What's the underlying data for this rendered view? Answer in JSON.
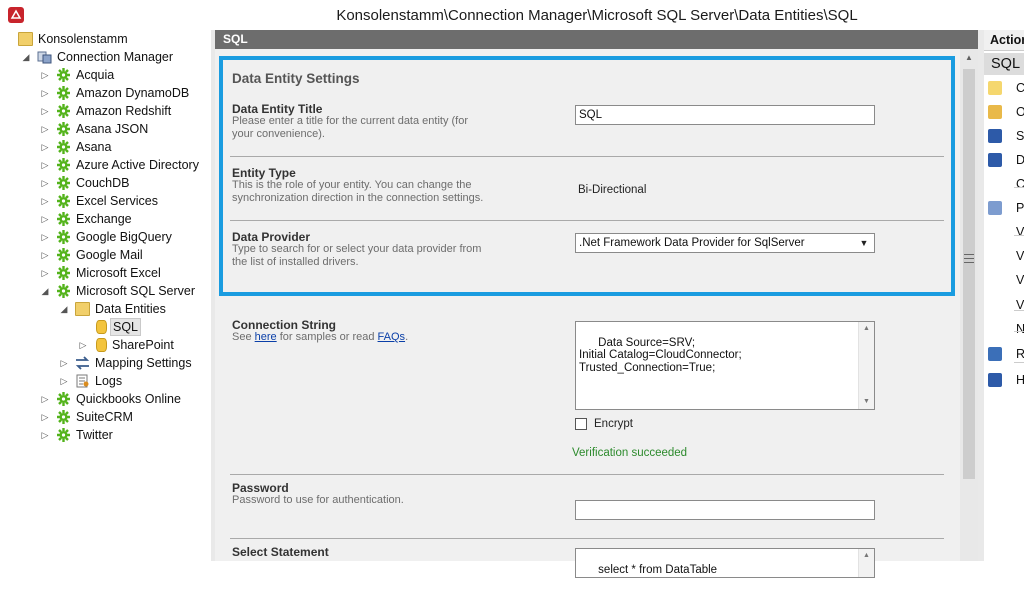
{
  "window": {
    "title": "Konsolenstamm\\Connection Manager\\Microsoft SQL Server\\Data Entities\\SQL"
  },
  "tree": {
    "root": "Konsolenstamm",
    "manager": "Connection Manager",
    "connectors": [
      "Acquia",
      "Amazon DynamoDB",
      "Amazon Redshift",
      "Asana JSON",
      "Asana",
      "Azure Active Directory",
      "CouchDB",
      "Excel Services",
      "Exchange",
      "Google BigQuery",
      "Google Mail",
      "Microsoft Excel",
      "Microsoft SQL Server"
    ],
    "sql_children": {
      "data_entities": "Data Entities",
      "sql": "SQL",
      "sharepoint": "SharePoint",
      "mapping": "Mapping Settings",
      "logs": "Logs"
    },
    "connectors_after": [
      "Quickbooks Online",
      "SuiteCRM",
      "Twitter"
    ]
  },
  "center": {
    "header": "SQL",
    "settings_heading": "Data Entity Settings",
    "title_field": {
      "label": "Data Entity Title",
      "desc": "Please enter a title for the current data entity (for your convenience).",
      "value": "SQL"
    },
    "entity_type": {
      "label": "Entity Type",
      "desc": "This is the role of your entity. You can change the synchronization direction in the connection settings.",
      "value": "Bi-Directional"
    },
    "provider": {
      "label": "Data Provider",
      "desc": "Type to search for or select your data provider from the list of installed drivers.",
      "value": ".Net Framework Data Provider for SqlServer"
    },
    "connection": {
      "label": "Connection String",
      "desc_prefix": "See ",
      "here_link": "here",
      "desc_middle": " for samples or read ",
      "faq_link": "FAQs",
      "desc_suffix": ".",
      "value": "Data Source=SRV;\nInitial Catalog=CloudConnector;\nTrusted_Connection=True;",
      "encrypt_label": "Encrypt",
      "status": "Verification succeeded"
    },
    "password": {
      "label": "Password",
      "desc": "Password to use for authentication.",
      "value": ""
    },
    "select": {
      "label": "Select Statement",
      "value": "select * from DataTable"
    }
  },
  "actions": {
    "header": "Action",
    "section": "SQL",
    "items": [
      "C",
      "O",
      "Sa",
      "D",
      "C",
      "P",
      "V",
      "V",
      "V",
      "V",
      "N",
      "R",
      "H"
    ]
  },
  "colors": {
    "highlight_border": "#1a9ce0",
    "header_bg": "#6d6d6d",
    "success": "#2c8a2c",
    "link": "#0a3fa8"
  }
}
